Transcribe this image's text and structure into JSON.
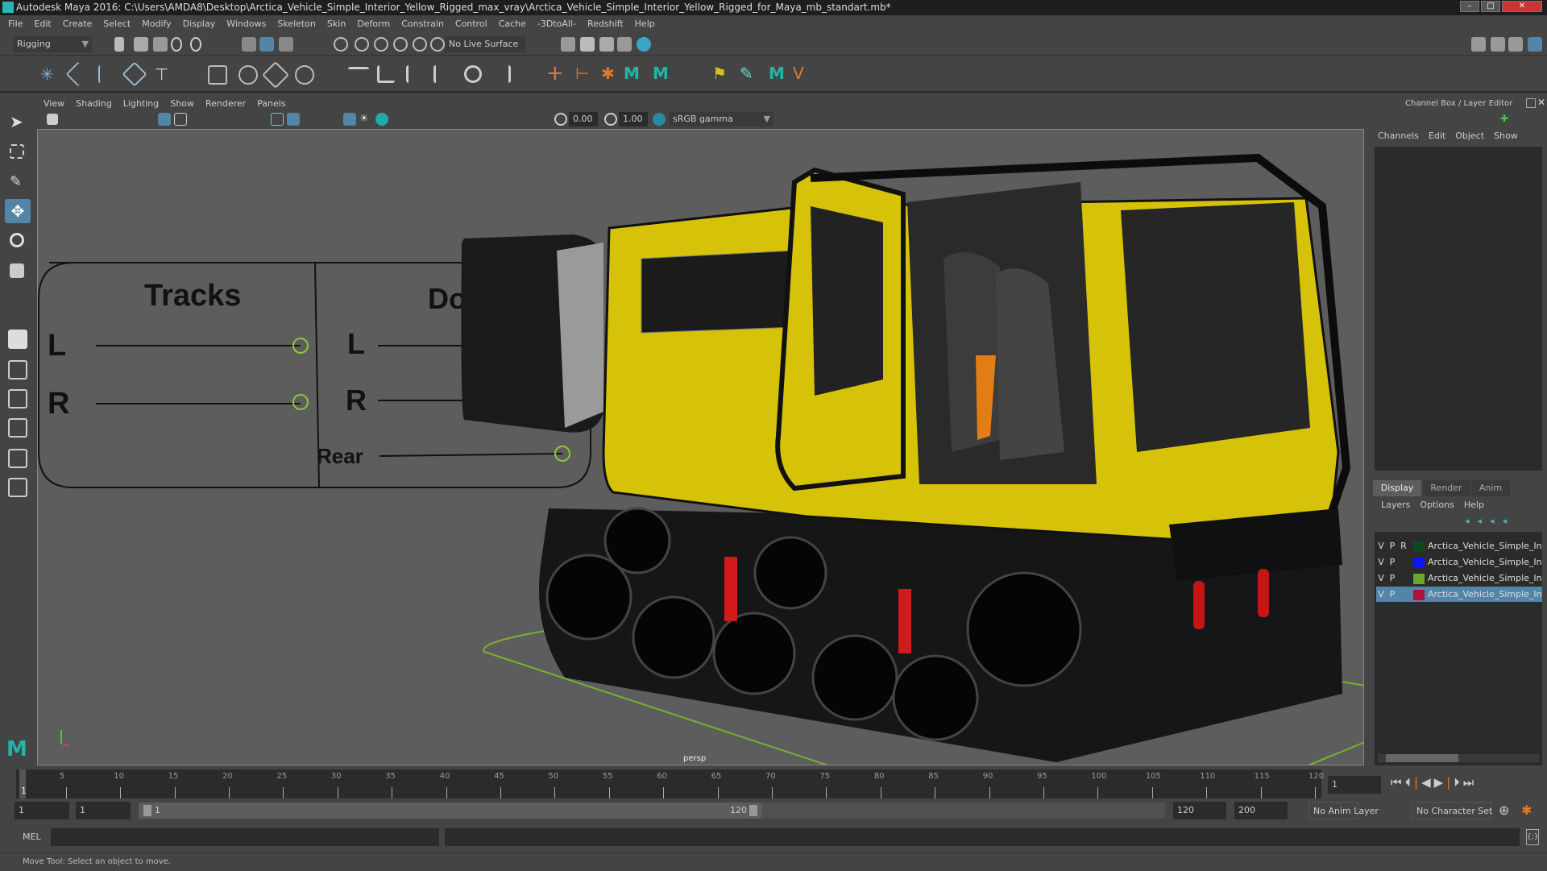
{
  "window": {
    "title": "Autodesk Maya 2016: C:\\Users\\AMDA8\\Desktop\\Arctica_Vehicle_Simple_Interior_Yellow_Rigged_max_vray\\Arctica_Vehicle_Simple_Interior_Yellow_Rigged_for_Maya_mb_standart.mb*"
  },
  "menu": [
    "File",
    "Edit",
    "Create",
    "Select",
    "Modify",
    "Display",
    "Windows",
    "Skeleton",
    "Skin",
    "Deform",
    "Constrain",
    "Control",
    "Cache",
    "-3DtoAll-",
    "Redshift",
    "Help"
  ],
  "statusline": {
    "mode": "Rigging",
    "live_surface": "No Live Surface"
  },
  "viewport": {
    "menu": [
      "View",
      "Shading",
      "Lighting",
      "Show",
      "Renderer",
      "Panels"
    ],
    "exposure": "0.00",
    "gamma": "1.00",
    "color_space": "sRGB gamma",
    "camera": "persp",
    "rig_panel": {
      "tracks": "Tracks",
      "doors": "Doors",
      "track_l": "L",
      "track_r": "R",
      "door_l": "L",
      "door_r": "R",
      "rear": "Rear"
    }
  },
  "channel_box": {
    "title": "Channel Box / Layer Editor",
    "menu": [
      "Channels",
      "Edit",
      "Object",
      "Show"
    ]
  },
  "layer_editor": {
    "tabs": [
      "Display",
      "Render",
      "Anim"
    ],
    "active_tab": "Display",
    "menu": [
      "Layers",
      "Options",
      "Help"
    ],
    "layers": [
      {
        "v": "V",
        "p": "P",
        "r": "R",
        "color": "#0b4a1e",
        "name": "Arctica_Vehicle_Simple_Interior"
      },
      {
        "v": "V",
        "p": "P",
        "r": "",
        "color": "#0a14ff",
        "name": "Arctica_Vehicle_Simple_Interior"
      },
      {
        "v": "V",
        "p": "P",
        "r": "",
        "color": "#6aa52f",
        "name": "Arctica_Vehicle_Simple_Interior"
      },
      {
        "v": "V",
        "p": "P",
        "r": "",
        "color": "#b0123a",
        "name": "Arctica_Vehicle_Simple_Interior",
        "selected": true
      }
    ]
  },
  "timeline": {
    "ticks": [
      5,
      10,
      15,
      20,
      25,
      30,
      35,
      40,
      45,
      50,
      55,
      60,
      65,
      70,
      75,
      80,
      85,
      90,
      95,
      100,
      105,
      110,
      115,
      120
    ],
    "current_frame": "1",
    "current_field": "1"
  },
  "range": {
    "start": "1",
    "playback_start": "1",
    "slider_start": "1",
    "slider_end": "120",
    "playback_end": "120",
    "end": "200",
    "anim_layer": "No Anim Layer",
    "character_set": "No Character Set"
  },
  "command_line": {
    "label": "MEL"
  },
  "help_line": "Move Tool: Select an object to move.",
  "colors": {
    "accent": "#5285a6",
    "grid": "#7ab030",
    "vehicle": "#d7c20a"
  }
}
